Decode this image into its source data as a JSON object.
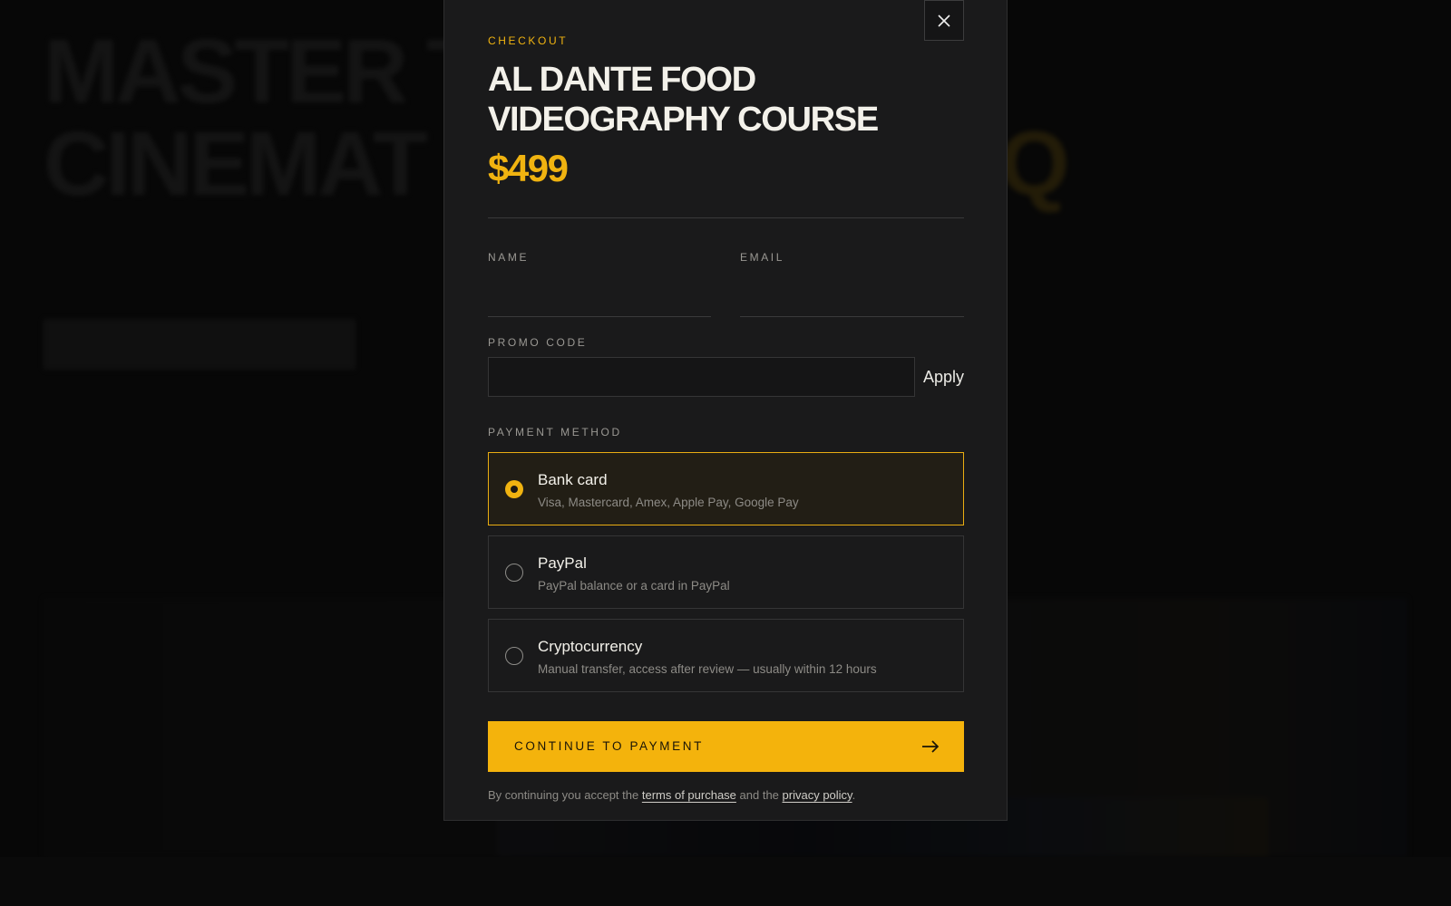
{
  "background": {
    "hero_title_line1": "MASTER T",
    "hero_title_line2": "CINEMAT",
    "hero_title_accent": "Q"
  },
  "modal": {
    "eyebrow": "CHECKOUT",
    "title": "AL DANTE FOOD VIDEOGRAPHY COURSE",
    "price": "$499",
    "close_icon": "close-icon",
    "fields": {
      "name_label": "NAME",
      "name_value": "",
      "email_label": "EMAIL",
      "email_value": "",
      "promo_label": "PROMO CODE",
      "promo_value": "",
      "apply_label": "Apply"
    },
    "payment": {
      "label": "PAYMENT METHOD",
      "selected_index": 0,
      "options": [
        {
          "title": "Bank card",
          "subtitle": "Visa, Mastercard, Amex, Apple Pay, Google Pay"
        },
        {
          "title": "PayPal",
          "subtitle": "PayPal balance or a card in PayPal"
        },
        {
          "title": "Cryptocurrency",
          "subtitle": "Manual transfer, access after review — usually within 12 hours"
        }
      ]
    },
    "cta": {
      "label": "CONTINUE TO PAYMENT",
      "icon": "arrow-right-icon"
    },
    "legal": {
      "prefix": "By continuing you accept the",
      "terms_link": "terms of purchase",
      "middle": "and the",
      "privacy_link": "privacy policy",
      "suffix": "."
    }
  },
  "colors": {
    "accent": "#f4b30c",
    "modal_bg": "#1a1a1b",
    "page_bg": "#0b0b0b"
  }
}
